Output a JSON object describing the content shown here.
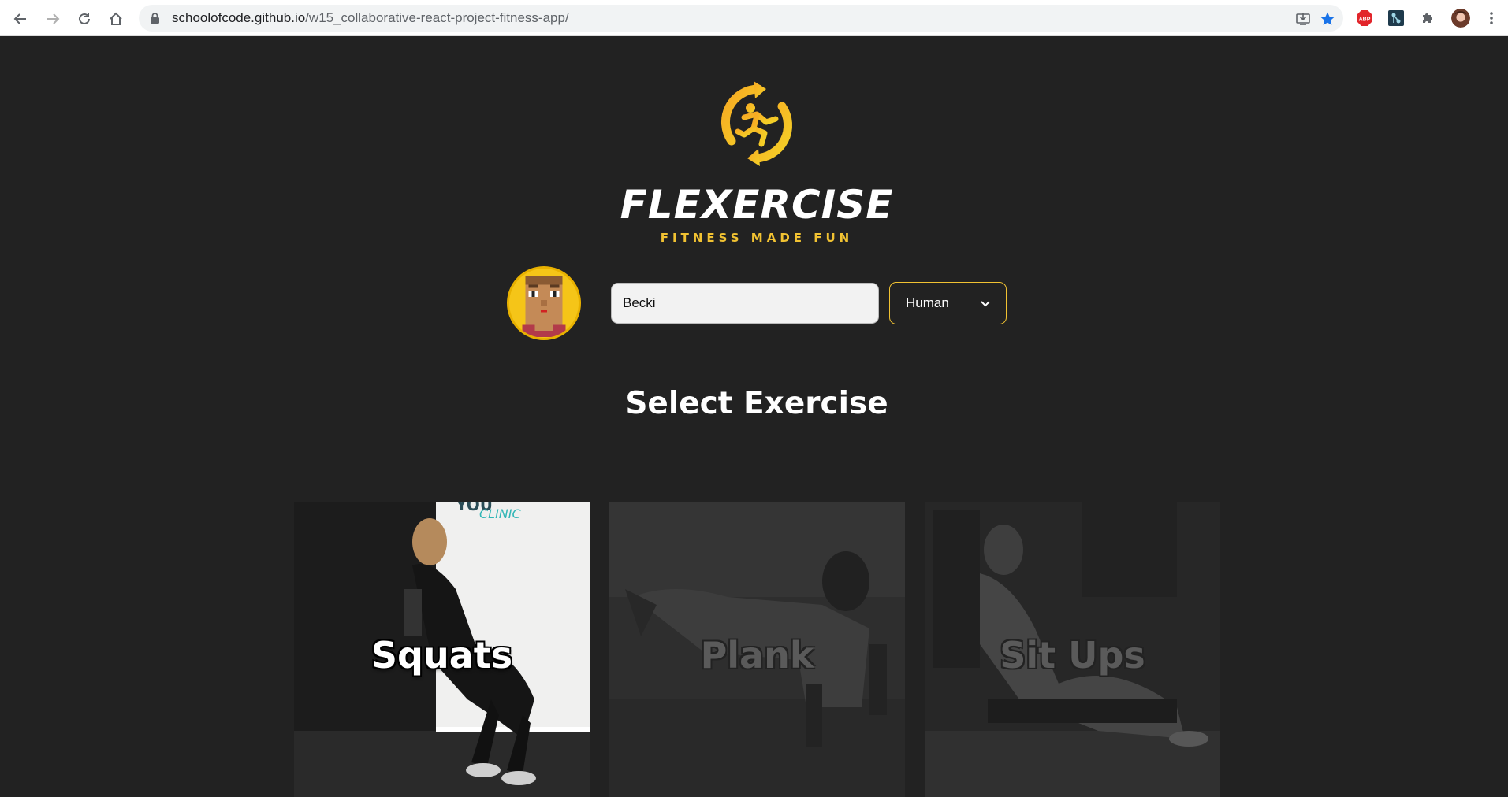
{
  "browser": {
    "url_host": "schoolofcode.github.io",
    "url_path": "/w15_collaborative-react-project-fitness-app/",
    "extensions": [
      "abp-icon",
      "extension-icon",
      "puzzle-icon",
      "profile-avatar"
    ]
  },
  "brand": {
    "name": "FLEXERCISE",
    "tagline": "FITNESS MADE FUN",
    "accent_color": "#f1c232"
  },
  "profile": {
    "name_value": "Becki",
    "species_selected": "Human"
  },
  "exercise_section": {
    "title": "Select Exercise",
    "cards": [
      {
        "label": "Squats",
        "state": "active"
      },
      {
        "label": "Plank",
        "state": "dimmed"
      },
      {
        "label": "Sit Ups",
        "state": "dimmed"
      }
    ]
  }
}
